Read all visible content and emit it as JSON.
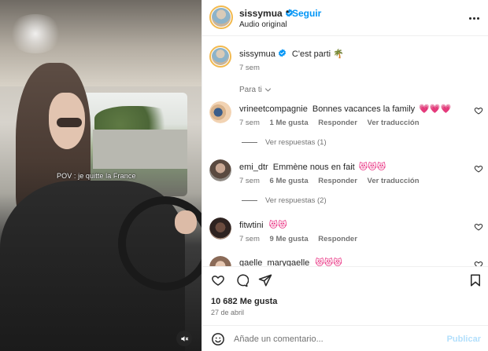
{
  "video": {
    "caption": "POV : je quitte la France",
    "mute_icon": "muted-speaker-icon"
  },
  "header": {
    "username": "sissymua",
    "separator": "•",
    "follow_label": "Seguir",
    "subtitle": "Audio original",
    "more_icon": "more-options-icon"
  },
  "post": {
    "username": "sissymua",
    "caption": "C'est parti 🌴",
    "time": "7 sem"
  },
  "sort": {
    "label": "Para ti"
  },
  "comments": [
    {
      "username": "vrineetcompagnie",
      "text": "Bonnes vacances la family",
      "emoji": "💗💗💗",
      "time": "7 sem",
      "likes": "1 Me gusta",
      "reply": "Responder",
      "translate": "Ver traducción",
      "replies": "Ver respuestas (1)"
    },
    {
      "username": "emi_dtr",
      "text": "Emmène nous en fait",
      "emoji": "😻😻😻",
      "time": "7 sem",
      "likes": "6 Me gusta",
      "reply": "Responder",
      "translate": "Ver traducción",
      "replies": "Ver respuestas (2)"
    },
    {
      "username": "fitwtini",
      "text": "",
      "emoji": "😻😻",
      "time": "7 sem",
      "likes": "9 Me gusta",
      "reply": "Responder"
    },
    {
      "username": "gaelle_marygaelle",
      "text": "",
      "emoji": "😻😻😻"
    }
  ],
  "stats": {
    "likes": "10 682 Me gusta",
    "date": "27 de abril"
  },
  "composer": {
    "placeholder": "Añade un comentario...",
    "publish_label": "Publicar"
  },
  "colors": {
    "link_blue": "#0095f6",
    "publish_disabled": "#b2dffc",
    "secondary_text": "#737373"
  }
}
